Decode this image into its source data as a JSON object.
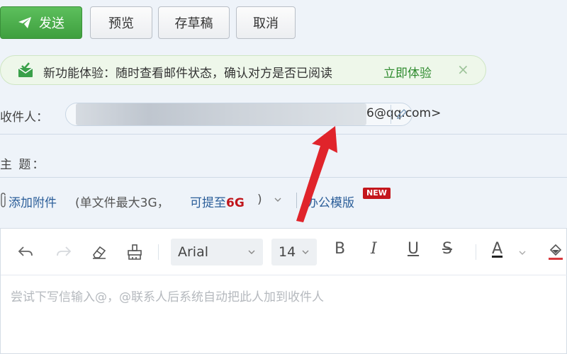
{
  "toolbar": {
    "send_label": "发送",
    "preview_label": "预览",
    "draft_label": "存草稿",
    "cancel_label": "取消"
  },
  "notice": {
    "text": "新功能体验：随时查看邮件状态，确认对方是否已阅读",
    "link": "立即体验",
    "close": "×"
  },
  "recipient": {
    "label": "收件人：",
    "value_tail": "6@qq.com>"
  },
  "subject": {
    "label": "主 题：",
    "value": ""
  },
  "attachments": {
    "add_label": "添加附件",
    "note": "(单文件最大3G，",
    "upgrade_prefix": "可提至",
    "upgrade_size": "6G",
    "close_paren": ")",
    "template_label": "办公模版",
    "new_badge": "NEW"
  },
  "editor": {
    "font_family": "Arial",
    "font_size": "14",
    "bold_label": "B",
    "italic_label": "I",
    "underline_label": "U",
    "strike_label": "S",
    "text_color_label": "A",
    "placeholder": "尝试下写信输入@，@联系人后系统自动把此人加到收件人"
  },
  "colors": {
    "send_button": "#4caf50",
    "notice_link": "#2e8b2e",
    "upgrade_size": "#c0161c",
    "new_badge": "#c4161c",
    "annotation_arrow": "#e0242b"
  }
}
